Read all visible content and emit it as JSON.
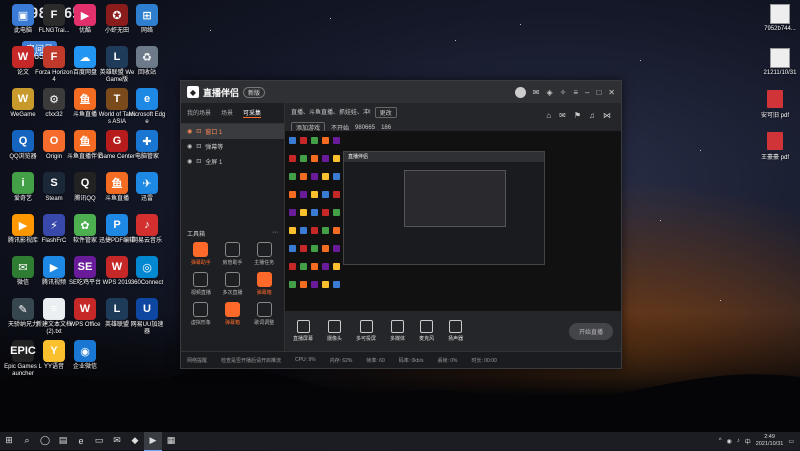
{
  "overlay": {
    "room_label": "房间号",
    "room_number": "980665"
  },
  "desktop_icons": [
    {
      "label": "此电脑",
      "color": "#3a7bd5",
      "glyph": "▣"
    },
    {
      "label": "FLNGTrai...",
      "color": "#2b2b2b",
      "glyph": "F"
    },
    {
      "label": "优酷",
      "color": "#e1306c",
      "glyph": "▶"
    },
    {
      "label": "小虾无田",
      "color": "#8a1c1c",
      "glyph": "✪"
    },
    {
      "label": "网络",
      "color": "#2f7fd1",
      "glyph": "⊞"
    },
    {
      "label": "论文",
      "color": "#c62828",
      "glyph": "W"
    },
    {
      "label": "Forza Horizon 4",
      "color": "#c0392b",
      "glyph": "F"
    },
    {
      "label": "百度网盘",
      "color": "#2196f3",
      "glyph": "☁"
    },
    {
      "label": "英雄联盟 WeGame版",
      "color": "#1f3b5a",
      "glyph": "L"
    },
    {
      "label": "回收站",
      "color": "#6c7a89",
      "glyph": "♻"
    },
    {
      "label": "WeGame",
      "color": "#c79a2b",
      "glyph": "W"
    },
    {
      "label": "cfxx32",
      "color": "#3b3b3b",
      "glyph": "⚙"
    },
    {
      "label": "斗鱼直播",
      "color": "#f36c21",
      "glyph": "鱼"
    },
    {
      "label": "World of Tanks ASIA",
      "color": "#7a4a1a",
      "glyph": "T"
    },
    {
      "label": "Microsoft Edge",
      "color": "#1e88e5",
      "glyph": "e"
    },
    {
      "label": "QQ浏览器",
      "color": "#1565c0",
      "glyph": "Q"
    },
    {
      "label": "Origin",
      "color": "#f56c2d",
      "glyph": "O"
    },
    {
      "label": "斗鱼直播伴侣",
      "color": "#f36c21",
      "glyph": "鱼"
    },
    {
      "label": "Game Center",
      "color": "#b71c1c",
      "glyph": "G"
    },
    {
      "label": "电脑管家",
      "color": "#1976d2",
      "glyph": "✚"
    },
    {
      "label": "爱奇艺",
      "color": "#43a047",
      "glyph": "i"
    },
    {
      "label": "Steam",
      "color": "#1b2838",
      "glyph": "S"
    },
    {
      "label": "腾讯QQ",
      "color": "#222",
      "glyph": "Q"
    },
    {
      "label": "斗鱼直播",
      "color": "#f36c21",
      "glyph": "鱼"
    },
    {
      "label": "迅雷",
      "color": "#1e88e5",
      "glyph": "✈"
    },
    {
      "label": "腾讯影视库",
      "color": "#ff9800",
      "glyph": "▶"
    },
    {
      "label": "FlashFrC",
      "color": "#3949ab",
      "glyph": "⚡"
    },
    {
      "label": "软件管家",
      "color": "#4caf50",
      "glyph": "✿"
    },
    {
      "label": "迅捷PDF编辑",
      "color": "#1e88e5",
      "glyph": "P"
    },
    {
      "label": "网易云音乐",
      "color": "#d32f2f",
      "glyph": "♪"
    },
    {
      "label": "微信",
      "color": "#2e7d32",
      "glyph": "✉"
    },
    {
      "label": "腾讯视频",
      "color": "#1e88e5",
      "glyph": "▶"
    },
    {
      "label": "SE吃鸡平台",
      "color": "#6a1b9a",
      "glyph": "SE"
    },
    {
      "label": "WPS 2019",
      "color": "#c62828",
      "glyph": "W"
    },
    {
      "label": "360Connect",
      "color": "#0288d1",
      "glyph": "◎"
    },
    {
      "label": "天骄纳兄力",
      "color": "#37474f",
      "glyph": "✎"
    },
    {
      "label": "新建文本文档 (2).txt",
      "color": "#eceff1",
      "glyph": "≡"
    },
    {
      "label": "WPS Office",
      "color": "#c62828",
      "glyph": "W"
    },
    {
      "label": "英雄联盟",
      "color": "#1f3b5a",
      "glyph": "L"
    },
    {
      "label": "网易UU加速器",
      "color": "#0d47a1",
      "glyph": "U"
    },
    {
      "label": "Epic Games Launcher",
      "color": "#222",
      "glyph": "EPIC"
    },
    {
      "label": "YY语音",
      "color": "#fbc02d",
      "glyph": "Y"
    },
    {
      "label": "企业微信",
      "color": "#1976d2",
      "glyph": "◉"
    }
  ],
  "right_icons": [
    {
      "label": "7952b744...",
      "kind": "pic"
    },
    {
      "label": "21211/10/31",
      "kind": "pic"
    },
    {
      "label": "安可旧 pdf",
      "kind": "pdf"
    },
    {
      "label": "王豪豪 pdf",
      "kind": "pdf"
    }
  ],
  "app": {
    "title": "直播伴侣",
    "version": "新版",
    "tabs": [
      "我的场景",
      "场景",
      "可采集"
    ],
    "sources": [
      "窗口 1",
      "弹幕等",
      "全屏 1"
    ],
    "toolbox_title": "工具箱",
    "tools": [
      {
        "label": "弹幕助手",
        "hot": true
      },
      {
        "label": "房管助手",
        "hot": false
      },
      {
        "label": "主播任务",
        "hot": false
      },
      {
        "label": "视频直播",
        "hot": false
      },
      {
        "label": "多次直播",
        "hot": false
      },
      {
        "label": "弹幕箱",
        "hot": true
      },
      {
        "label": "虚拟形象",
        "hot": false
      },
      {
        "label": "弹幕箱",
        "hot": true
      },
      {
        "label": "歌词调整",
        "hot": false
      }
    ],
    "header_row1": "直播、斗鱼直播、抓娃娃、冲!",
    "header_tag": "更改",
    "header_row2_btn": "添加游戏",
    "header_row2_status": "不开始",
    "header_row2_id": "980665",
    "header_row2_count": "186",
    "bottom_actions": [
      "直播屏幕",
      "摄像头",
      "多可投屏",
      "多媒体",
      "麦克风",
      "扬声器"
    ],
    "golive": "开始直播",
    "status_items": [
      "网络提醒",
      "检查是否开播后请开启推流",
      "CPU: 9%",
      "内存: 62%",
      "帧率: 60",
      "码率: 0kb/s",
      "丢帧: 0%",
      "时长: 00:00"
    ]
  },
  "taskbar": {
    "apps": [
      "⊞",
      "⌕",
      "◯",
      "▤",
      "e",
      "▭",
      "✉",
      "◆",
      "▶",
      "▦"
    ],
    "time": "2:49",
    "date": "2021/10/31"
  }
}
